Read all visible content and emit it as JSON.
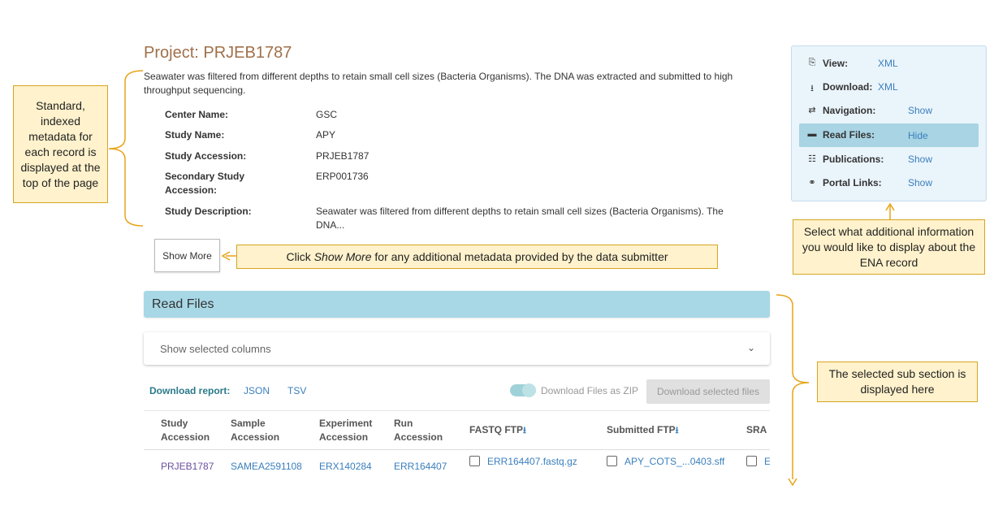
{
  "project": {
    "title": "Project: PRJEB1787",
    "description": "Seawater was filtered from different depths to retain small cell sizes (Bacteria Organisms). The DNA was extracted and submitted to high throughput sequencing."
  },
  "metadata": [
    {
      "key": "Center Name:",
      "value": "GSC"
    },
    {
      "key": "Study Name:",
      "value": "APY"
    },
    {
      "key": "Study Accession:",
      "value": "PRJEB1787"
    },
    {
      "key": "Secondary Study Accession:",
      "value": "ERP001736"
    },
    {
      "key": "Study Description:",
      "value": "Seawater was filtered from different depths to retain small cell sizes (Bacteria Organisms). The DNA..."
    }
  ],
  "show_more_label": "Show More",
  "side_panel": [
    {
      "icon": "file-code-icon",
      "glyph": "⎘",
      "label": "View:",
      "link": "XML"
    },
    {
      "icon": "download-icon",
      "glyph": "⭳",
      "label": "Download:",
      "link": "XML"
    },
    {
      "icon": "exchange-icon",
      "glyph": "⇄",
      "label": "Navigation:",
      "link": "Show"
    },
    {
      "icon": "folder-icon",
      "glyph": "▬",
      "label": "Read Files:",
      "link": "Hide"
    },
    {
      "icon": "book-icon",
      "glyph": "☷",
      "label": "Publications:",
      "link": "Show"
    },
    {
      "icon": "link-icon",
      "glyph": "⚭",
      "label": "Portal Links:",
      "link": "Show"
    }
  ],
  "read_files": {
    "header": "Read Files",
    "show_columns": "Show selected columns",
    "download_report_label": "Download report:",
    "report_formats": [
      "JSON",
      "TSV"
    ],
    "zip_toggle_label": "Download Files as ZIP",
    "download_selected_label": "Download selected files",
    "columns": [
      "Study Accession",
      "Sample Accession",
      "Experiment Accession",
      "Run Accession",
      "FASTQ FTP",
      "Submitted FTP",
      "SRA I"
    ],
    "row": [
      "PRJEB1787",
      "SAMEA2591108",
      "ERX140284",
      "ERR164407",
      "ERR164407.fastq.gz",
      "APY_COTS_...0403.sff",
      "E"
    ]
  },
  "callouts": {
    "left": "Standard, indexed metadata for each record is displayed at the top of the page",
    "show_more_prefix": "Click ",
    "show_more_em": "Show More",
    "show_more_suffix": " for any additional metadata provided by the data submitter",
    "panel": "Select what additional information you would like to display about the ENA record",
    "section": "The selected sub section is displayed here"
  },
  "colors": {
    "title": "#a0704a",
    "accent_blue": "#3a7fbd",
    "header_bg": "#a8d8e6",
    "callout_bg": "#fff2cc",
    "callout_border": "#d6a521"
  }
}
